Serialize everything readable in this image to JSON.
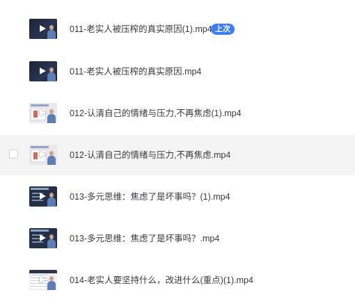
{
  "files": [
    {
      "name": "011-老实人被压榨的真实原因(1).mp4",
      "badge": "上次",
      "thumb": "dark"
    },
    {
      "name": "011-老实人被压榨的真实原因.mp4",
      "thumb": "dark"
    },
    {
      "name": "012-认清自己的情绪与压力,不再焦虑(1).mp4",
      "thumb": "light"
    },
    {
      "name": "012-认清自己的情绪与压力,不再焦虑.mp4",
      "thumb": "light",
      "hovered": true
    },
    {
      "name": "013-多元思维：焦虑了是坏事吗？(1).mp4",
      "thumb": "slide"
    },
    {
      "name": "013-多元思维：焦虑了是坏事吗？.mp4",
      "thumb": "slide"
    },
    {
      "name": "014-老实人要坚持什么，改进什么(重点)(1).mp4",
      "thumb": "table"
    }
  ],
  "colors": {
    "badge": "#3b7dff",
    "hover_row": "#f4f4f5",
    "text": "#3a3a3e"
  },
  "icons": {
    "play": "play-icon",
    "checkbox": "checkbox"
  }
}
